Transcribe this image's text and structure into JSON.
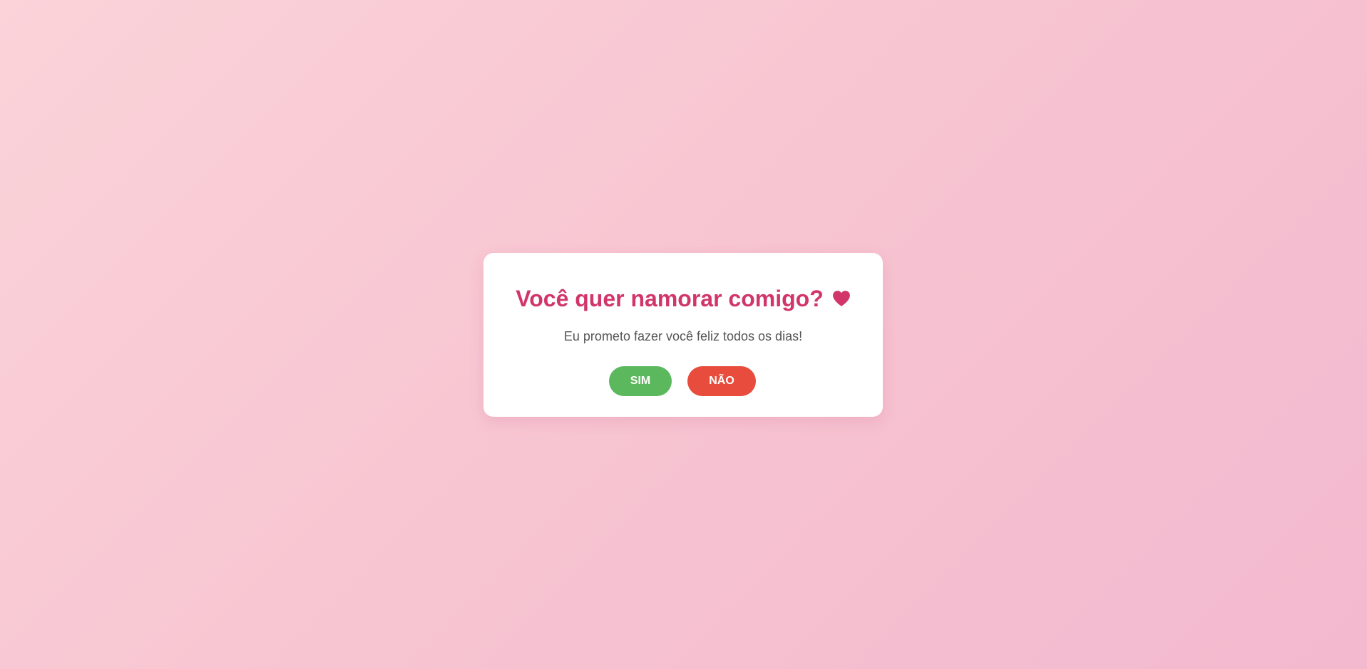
{
  "dialog": {
    "title": "Você quer namorar comigo?",
    "heart_icon": "heart-icon",
    "subtitle": "Eu prometo fazer você feliz todos os dias!",
    "yes_label": "SIM",
    "no_label": "NÃO"
  },
  "colors": {
    "title": "#d1356a",
    "yes_button": "#5cb85c",
    "no_button": "#e74c3c",
    "background_start": "#fbd3d9",
    "background_end": "#f3b9cf"
  }
}
